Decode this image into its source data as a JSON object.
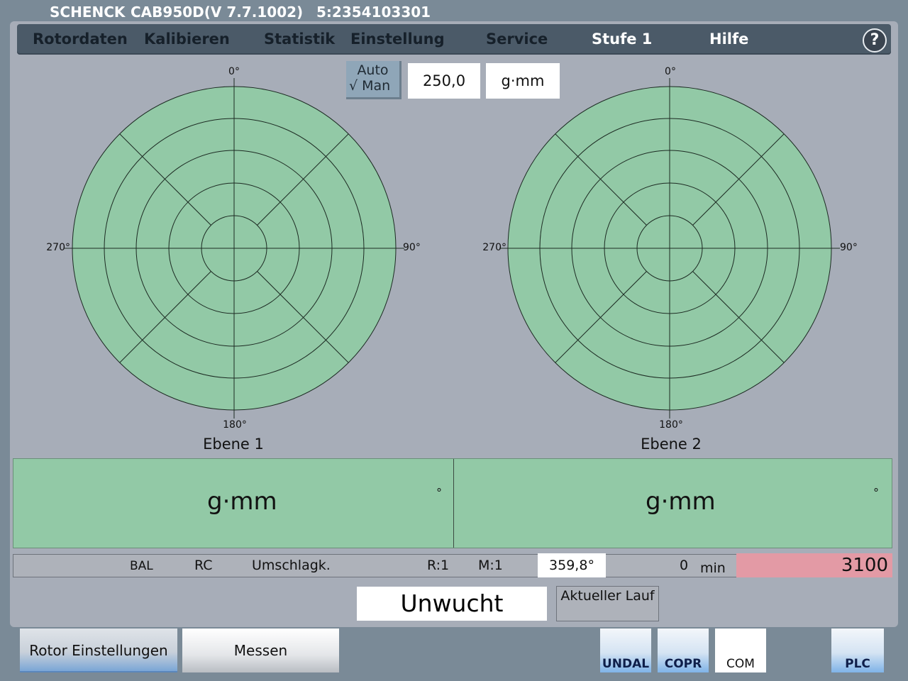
{
  "titlebar": {
    "brand": "SCHENCK",
    "model": "CAB950D(V 7.7.1002)",
    "serial": "5:2354103301"
  },
  "menu": {
    "items": [
      "Rotordaten",
      "Kalibieren",
      "Statistik",
      "Einstellung",
      "Service",
      "Stufe 1",
      "Hilfe"
    ],
    "help": "?"
  },
  "tolerance": {
    "auto_label": "Auto",
    "man_label": "√ Man",
    "value": "250,0",
    "unit": "g·mm"
  },
  "planes": [
    {
      "name": "Ebene  1",
      "angles": {
        "top": "0°",
        "right": "90°",
        "bottom": "180°",
        "left": "270°"
      },
      "unit": "g·mm",
      "degree_symbol": "°"
    },
    {
      "name": "Ebene  2",
      "angles": {
        "top": "0°",
        "right": "90°",
        "bottom": "180°",
        "left": "270°"
      },
      "unit": "g·mm",
      "degree_symbol": "°"
    }
  ],
  "status": {
    "bal": "BAL",
    "rc": "RC",
    "umschlag": "Umschlagk.",
    "r": "R:1",
    "m": "M:1",
    "angle": "359,8°",
    "count": "0",
    "speed_unit": "min",
    "speed_value": "3100"
  },
  "result": {
    "label": "Unwucht",
    "current_run": "Aktueller Lauf"
  },
  "bottom": {
    "rotor_settings": "Rotor Einstellungen",
    "measure": "Messen",
    "undal": "UNDAL",
    "copr": "COPR",
    "com": "COM",
    "plc": "PLC"
  },
  "colors": {
    "background": "#7a8a97",
    "panel": "#a7adb8",
    "menubar": "#4b5a68",
    "polar_fill": "#92c9a6",
    "speed_fill": "#e39aa5"
  }
}
